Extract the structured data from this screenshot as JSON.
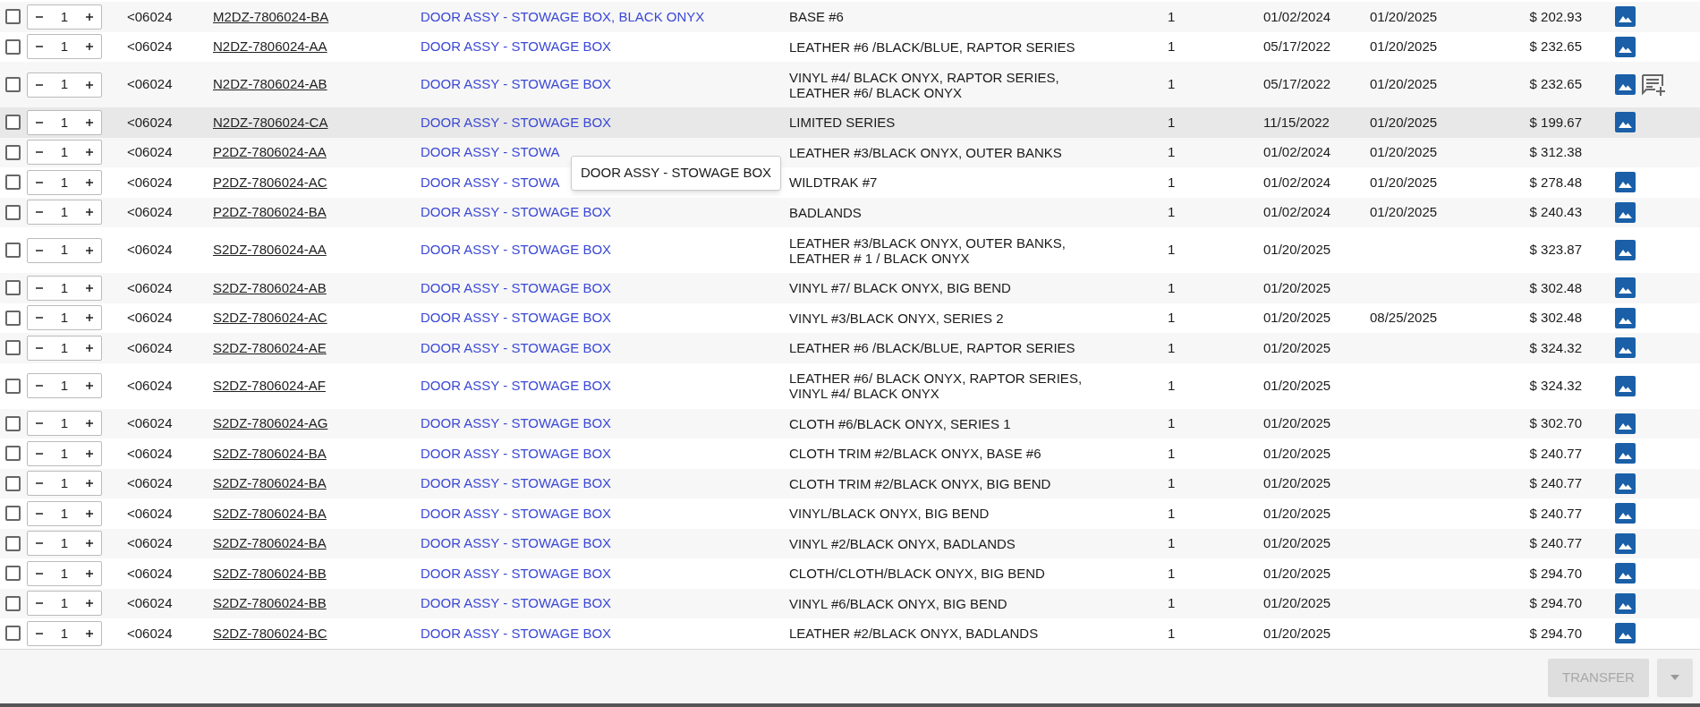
{
  "rows": [
    {
      "checked": false,
      "quantity": "1",
      "code": "<06024",
      "part": "M2DZ-7806024-BA",
      "description": "DOOR ASSY - STOWAGE BOX, BLACK ONYX",
      "details": [
        "BASE #6"
      ],
      "qty": "1",
      "date_1": "01/02/2024",
      "date_2": "01/20/2025",
      "price": "$ 202.93",
      "has_image": true,
      "has_note": false,
      "highlighted": false
    },
    {
      "checked": false,
      "quantity": "1",
      "code": "<06024",
      "part": "N2DZ-7806024-AA",
      "description": "DOOR ASSY - STOWAGE BOX",
      "details": [
        "LEATHER #6 /BLACK/BLUE, RAPTOR SERIES"
      ],
      "qty": "1",
      "date_1": "05/17/2022",
      "date_2": "01/20/2025",
      "price": "$ 232.65",
      "has_image": true,
      "has_note": false,
      "highlighted": false
    },
    {
      "checked": false,
      "quantity": "1",
      "code": "<06024",
      "part": "N2DZ-7806024-AB",
      "description": "DOOR ASSY - STOWAGE BOX",
      "details": [
        "VINYL #4/ BLACK ONYX, RAPTOR SERIES,",
        "LEATHER #6/ BLACK ONYX"
      ],
      "qty": "1",
      "date_1": "05/17/2022",
      "date_2": "01/20/2025",
      "price": "$ 232.65",
      "has_image": true,
      "has_note": true,
      "highlighted": false
    },
    {
      "checked": false,
      "quantity": "1",
      "code": "<06024",
      "part": "N2DZ-7806024-CA",
      "description": "DOOR ASSY - STOWAGE BOX",
      "details": [
        "LIMITED SERIES"
      ],
      "qty": "1",
      "date_1": "11/15/2022",
      "date_2": "01/20/2025",
      "price": "$ 199.67",
      "has_image": true,
      "has_note": false,
      "highlighted": true
    },
    {
      "checked": false,
      "quantity": "1",
      "code": "<06024",
      "part": "P2DZ-7806024-AA",
      "description": "DOOR ASSY - STOWA",
      "details": [
        "LEATHER #3/BLACK ONYX, OUTER BANKS"
      ],
      "qty": "1",
      "date_1": "01/02/2024",
      "date_2": "01/20/2025",
      "price": "$ 312.38",
      "has_image": false,
      "has_note": false,
      "highlighted": false
    },
    {
      "checked": false,
      "quantity": "1",
      "code": "<06024",
      "part": "P2DZ-7806024-AC",
      "description": "DOOR ASSY - STOWA",
      "details": [
        "WILDTRAK #7"
      ],
      "qty": "1",
      "date_1": "01/02/2024",
      "date_2": "01/20/2025",
      "price": "$ 278.48",
      "has_image": true,
      "has_note": false,
      "highlighted": false
    },
    {
      "checked": false,
      "quantity": "1",
      "code": "<06024",
      "part": "P2DZ-7806024-BA",
      "description": "DOOR ASSY - STOWAGE BOX",
      "details": [
        "BADLANDS"
      ],
      "qty": "1",
      "date_1": "01/02/2024",
      "date_2": "01/20/2025",
      "price": "$ 240.43",
      "has_image": true,
      "has_note": false,
      "highlighted": false
    },
    {
      "checked": false,
      "quantity": "1",
      "code": "<06024",
      "part": "S2DZ-7806024-AA",
      "description": "DOOR ASSY - STOWAGE BOX",
      "details": [
        "LEATHER #3/BLACK ONYX, OUTER BANKS,",
        "LEATHER # 1 / BLACK ONYX"
      ],
      "qty": "1",
      "date_1": "01/20/2025",
      "price": "$ 323.87",
      "has_image": true,
      "has_note": false,
      "highlighted": false
    },
    {
      "checked": false,
      "quantity": "1",
      "code": "<06024",
      "part": "S2DZ-7806024-AB",
      "description": "DOOR ASSY - STOWAGE BOX",
      "details": [
        "VINYL #7/ BLACK ONYX, BIG BEND"
      ],
      "qty": "1",
      "date_1": "01/20/2025",
      "price": "$ 302.48",
      "has_image": true,
      "has_note": false,
      "highlighted": false
    },
    {
      "checked": false,
      "quantity": "1",
      "code": "<06024",
      "part": "S2DZ-7806024-AC",
      "description": "DOOR ASSY - STOWAGE BOX",
      "details": [
        "VINYL #3/BLACK ONYX, SERIES 2"
      ],
      "qty": "1",
      "date_1": "01/20/2025",
      "date_2": "08/25/2025",
      "price": "$ 302.48",
      "has_image": true,
      "has_note": false,
      "highlighted": false
    },
    {
      "checked": false,
      "quantity": "1",
      "code": "<06024",
      "part": "S2DZ-7806024-AE",
      "description": "DOOR ASSY - STOWAGE BOX",
      "details": [
        "LEATHER #6 /BLACK/BLUE, RAPTOR SERIES"
      ],
      "qty": "1",
      "date_1": "01/20/2025",
      "price": "$ 324.32",
      "has_image": true,
      "has_note": false,
      "highlighted": false
    },
    {
      "checked": false,
      "quantity": "1",
      "code": "<06024",
      "part": "S2DZ-7806024-AF",
      "description": "DOOR ASSY - STOWAGE BOX",
      "details": [
        "LEATHER #6/ BLACK ONYX, RAPTOR SERIES,",
        "VINYL #4/ BLACK ONYX"
      ],
      "qty": "1",
      "date_1": "01/20/2025",
      "price": "$ 324.32",
      "has_image": true,
      "has_note": false,
      "highlighted": false
    },
    {
      "checked": false,
      "quantity": "1",
      "code": "<06024",
      "part": "S2DZ-7806024-AG",
      "description": "DOOR ASSY - STOWAGE BOX",
      "details": [
        "CLOTH #6/BLACK ONYX, SERIES 1"
      ],
      "qty": "1",
      "date_1": "01/20/2025",
      "price": "$ 302.70",
      "has_image": true,
      "has_note": false,
      "highlighted": false
    },
    {
      "checked": false,
      "quantity": "1",
      "code": "<06024",
      "part": "S2DZ-7806024-BA",
      "description": "DOOR ASSY - STOWAGE BOX",
      "details": [
        "CLOTH TRIM #2/BLACK ONYX, BASE #6"
      ],
      "qty": "1",
      "date_1": "01/20/2025",
      "price": "$ 240.77",
      "has_image": true,
      "has_note": false,
      "highlighted": false
    },
    {
      "checked": false,
      "quantity": "1",
      "code": "<06024",
      "part": "S2DZ-7806024-BA",
      "description": "DOOR ASSY - STOWAGE BOX",
      "details": [
        "CLOTH TRIM #2/BLACK ONYX, BIG BEND"
      ],
      "qty": "1",
      "date_1": "01/20/2025",
      "price": "$ 240.77",
      "has_image": true,
      "has_note": false,
      "highlighted": false
    },
    {
      "checked": false,
      "quantity": "1",
      "code": "<06024",
      "part": "S2DZ-7806024-BA",
      "description": "DOOR ASSY - STOWAGE BOX",
      "details": [
        "VINYL/BLACK ONYX, BIG BEND"
      ],
      "qty": "1",
      "date_1": "01/20/2025",
      "price": "$ 240.77",
      "has_image": true,
      "has_note": false,
      "highlighted": false
    },
    {
      "checked": false,
      "quantity": "1",
      "code": "<06024",
      "part": "S2DZ-7806024-BA",
      "description": "DOOR ASSY - STOWAGE BOX",
      "details": [
        "VINYL #2/BLACK ONYX, BADLANDS"
      ],
      "qty": "1",
      "date_1": "01/20/2025",
      "price": "$ 240.77",
      "has_image": true,
      "has_note": false,
      "highlighted": false
    },
    {
      "checked": false,
      "quantity": "1",
      "code": "<06024",
      "part": "S2DZ-7806024-BB",
      "description": "DOOR ASSY - STOWAGE BOX",
      "details": [
        "CLOTH/CLOTH/BLACK ONYX, BIG BEND"
      ],
      "qty": "1",
      "date_1": "01/20/2025",
      "price": "$ 294.70",
      "has_image": true,
      "has_note": false,
      "highlighted": false
    },
    {
      "checked": false,
      "quantity": "1",
      "code": "<06024",
      "part": "S2DZ-7806024-BB",
      "description": "DOOR ASSY - STOWAGE BOX",
      "details": [
        "VINYL #6/BLACK ONYX, BIG BEND"
      ],
      "qty": "1",
      "date_1": "01/20/2025",
      "price": "$ 294.70",
      "has_image": true,
      "has_note": false,
      "highlighted": false
    },
    {
      "checked": false,
      "quantity": "1",
      "code": "<06024",
      "part": "S2DZ-7806024-BC",
      "description": "DOOR ASSY - STOWAGE BOX",
      "details": [
        "LEATHER #2/BLACK ONYX, BADLANDS"
      ],
      "qty": "1",
      "date_1": "01/20/2025",
      "price": "$ 294.70",
      "has_image": true,
      "has_note": false,
      "highlighted": false
    }
  ],
  "tooltip": {
    "text": "DOOR ASSY - STOWAGE BOX"
  },
  "footer": {
    "transfer_button": {
      "label": "TRANSFER",
      "disabled": true
    }
  }
}
